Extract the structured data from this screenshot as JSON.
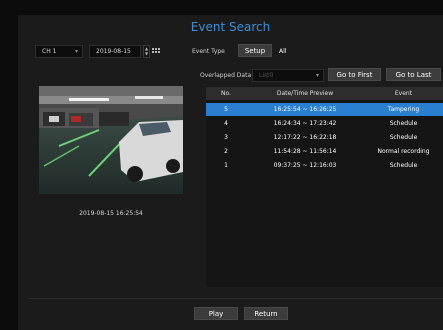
{
  "title": "Event Search",
  "channel": {
    "value": "CH 1"
  },
  "date": {
    "value": "2019-08-15"
  },
  "event_type": {
    "label": "Event Type",
    "setup_label": "Setup",
    "value": "All"
  },
  "overlapped": {
    "label": "Overlapped Data",
    "value": "List0"
  },
  "buttons": {
    "first": "Go to First",
    "last": "Go to Last",
    "play": "Play",
    "return": "Return"
  },
  "preview": {
    "timestamp": "2019-08-15 16:25:54"
  },
  "table": {
    "headers": [
      "No.",
      "Date/Time Preview",
      "Event"
    ],
    "rows": [
      {
        "no": "5",
        "time": "16:25:54 ~ 16:26:25",
        "event": "Tampering"
      },
      {
        "no": "4",
        "time": "16:24:34 ~ 17:23:42",
        "event": "Schedule"
      },
      {
        "no": "3",
        "time": "12:17:22 ~ 16:22:18",
        "event": "Schedule"
      },
      {
        "no": "2",
        "time": "11:54:28 ~ 11:56:14",
        "event": "Normal recording"
      },
      {
        "no": "1",
        "time": "09:37:25 ~ 12:16:03",
        "event": "Schedule"
      }
    ]
  },
  "colors": {
    "accent": "#3b8fd8",
    "selected_row": "#2b7fd1"
  }
}
